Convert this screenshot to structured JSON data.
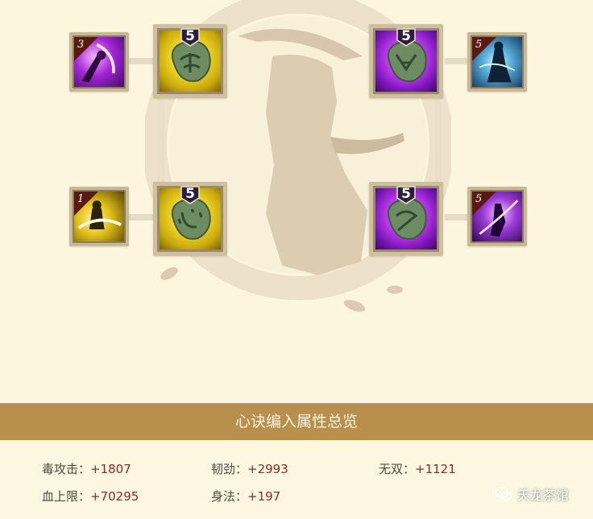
{
  "slots": {
    "top_left_skill": {
      "level": "3",
      "icon": "dark-blade-skill-icon"
    },
    "top_left_gem": {
      "level": "5",
      "icon": "gold-jade-stone-icon"
    },
    "top_right_gem": {
      "level": "5",
      "icon": "purple-jade-stone-icon"
    },
    "top_right_skill": {
      "level": "5",
      "icon": "blue-spirit-skill-icon"
    },
    "bottom_left_skill": {
      "level": "1",
      "icon": "golden-whirl-skill-icon"
    },
    "bottom_left_gem": {
      "level": "5",
      "icon": "gold-jade-stone-heart-icon"
    },
    "bottom_right_gem": {
      "level": "5",
      "icon": "purple-jade-stone-icon"
    },
    "bottom_right_skill": {
      "level": "5",
      "icon": "violet-slash-skill-icon"
    }
  },
  "summary": {
    "title": "心诀编入属性总览",
    "stats": [
      {
        "label": "毒攻击：",
        "value": "+1807"
      },
      {
        "label": "韧劲：",
        "value": "+2993"
      },
      {
        "label": "无双：",
        "value": "+1121"
      },
      {
        "label": "血上限：",
        "value": "+70295"
      },
      {
        "label": "身法：",
        "value": "+197"
      }
    ]
  },
  "watermark": {
    "text": "天龙茶馆",
    "icon": "wechat-logo-icon"
  },
  "colors": {
    "banner": "#b88f4d",
    "value": "#8c2a20",
    "label": "#4e4a44"
  }
}
